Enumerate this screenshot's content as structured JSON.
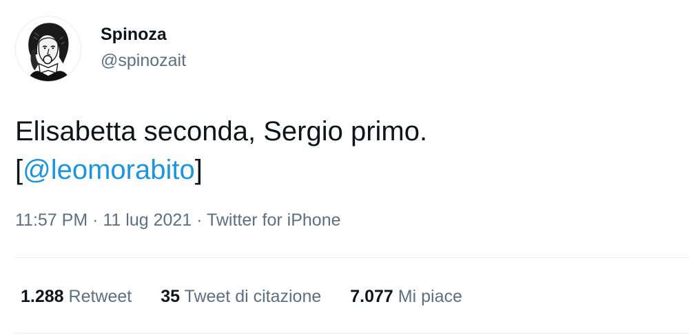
{
  "author": {
    "display_name": "Spinoza",
    "handle": "@spinozait",
    "avatar_icon": "spinoza-portrait-avatar"
  },
  "tweet": {
    "text_line1": "Elisabetta seconda, Sergio primo.",
    "bracket_open": "[",
    "mention": "@leomorabito",
    "bracket_close": "]"
  },
  "meta": {
    "time": "11:57 PM",
    "separator": " · ",
    "date": "11 lug 2021",
    "source": "Twitter for iPhone"
  },
  "stats": {
    "retweets": {
      "count": "1.288",
      "label": "Retweet"
    },
    "quotes": {
      "count": "35",
      "label": "Tweet di citazione"
    },
    "likes": {
      "count": "7.077",
      "label": "Mi piace"
    }
  },
  "colors": {
    "link": "#1b95e0",
    "secondary": "#5b7083",
    "primary": "#0f1419",
    "divider": "#e6ecf0"
  }
}
